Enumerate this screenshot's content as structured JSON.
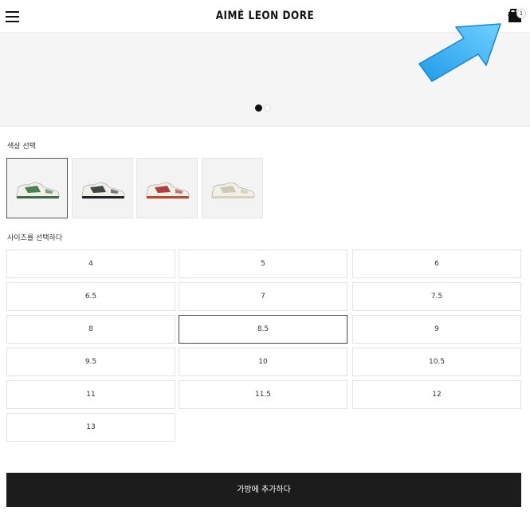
{
  "header": {
    "brand": "AIMÉ LEON DORE",
    "menu_icon": "hamburger-menu-icon",
    "bag_icon": "shopping-bag-icon",
    "bag_count": "1"
  },
  "carousel": {
    "dot_count": 2,
    "active_index": 0
  },
  "color_section": {
    "label": "색상 선택",
    "swatches": [
      {
        "name": "green",
        "accent": "#2e6b3a",
        "sole": "#3f6a46"
      },
      {
        "name": "black",
        "accent": "#1f2a24",
        "sole": "#222222"
      },
      {
        "name": "red",
        "accent": "#a31f24",
        "sole": "#b84a2a"
      },
      {
        "name": "cream",
        "accent": "#c9c1a8",
        "sole": "#d9d2bc"
      }
    ],
    "selected_index": 0
  },
  "size_section": {
    "label": "사이즈를 선택하다",
    "sizes": [
      "4",
      "5",
      "6",
      "6.5",
      "7",
      "7.5",
      "8",
      "8.5",
      "9",
      "9.5",
      "10",
      "10.5",
      "11",
      "11.5",
      "12",
      "13"
    ],
    "selected": "8.5"
  },
  "add_to_bag": {
    "label": "가방에 추가하다"
  },
  "colors": {
    "button_bg": "#1c1c1c",
    "arrow": "#2aa7ee"
  }
}
